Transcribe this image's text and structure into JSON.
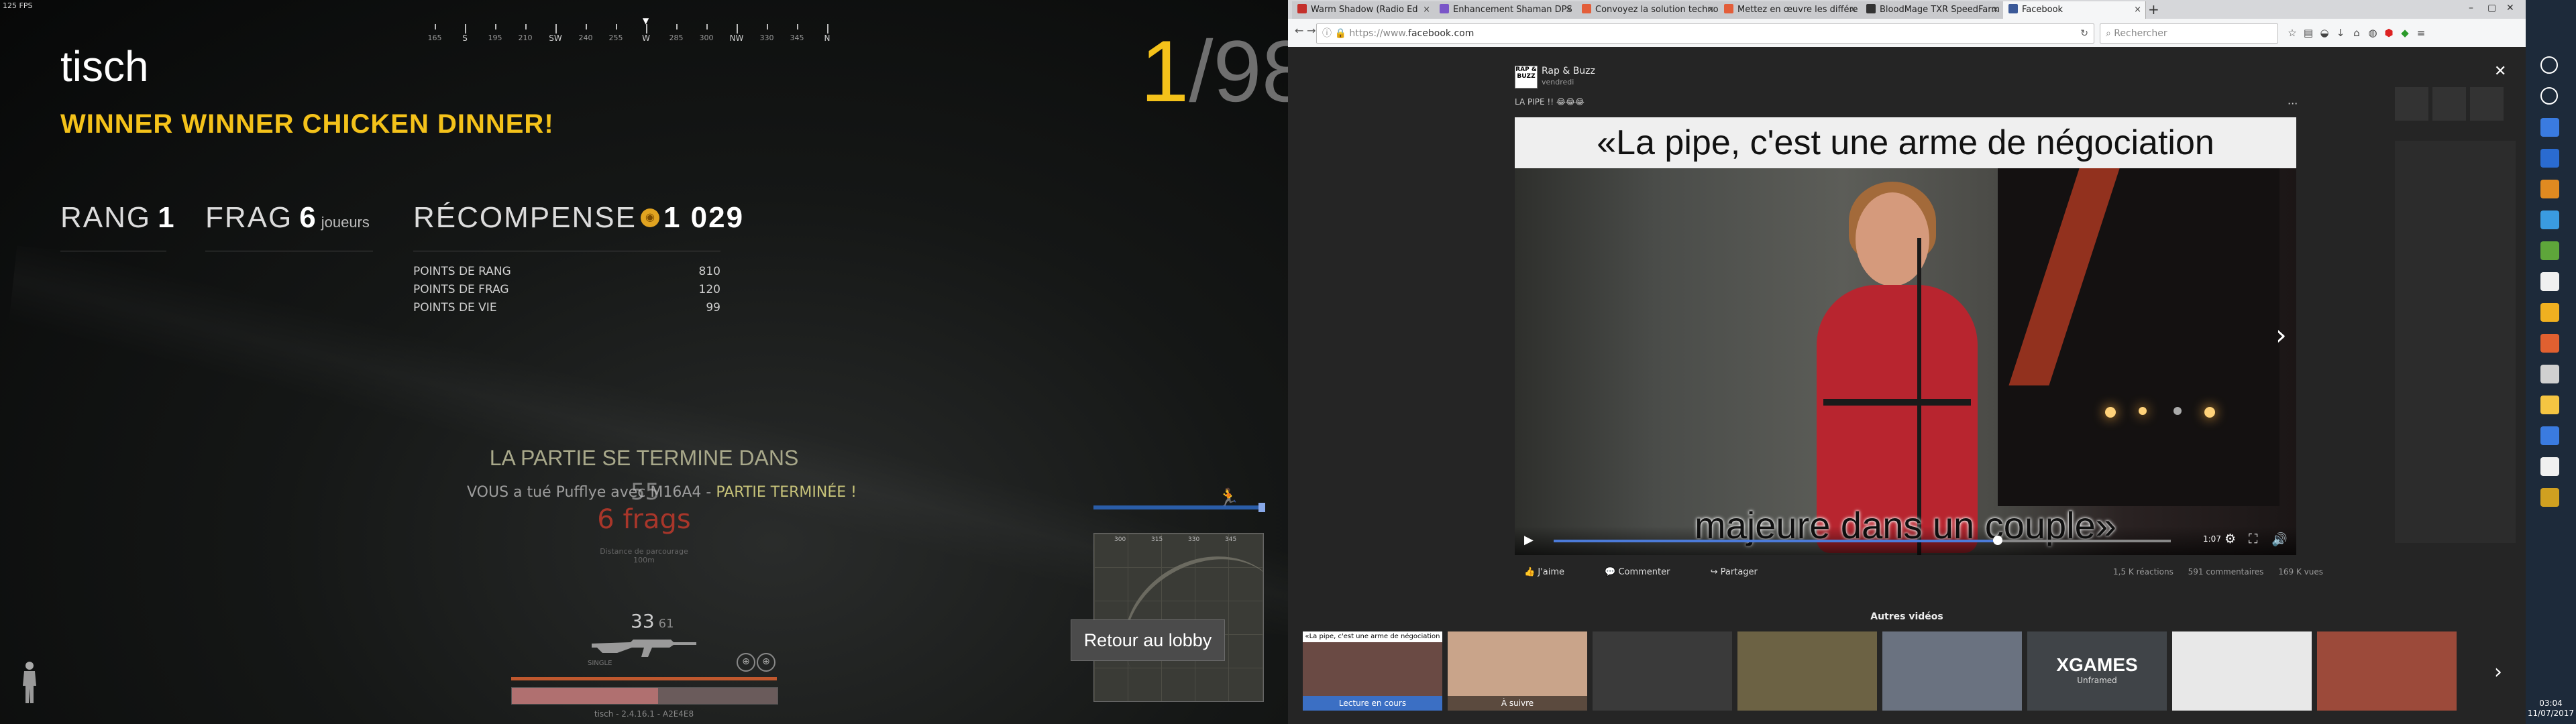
{
  "game": {
    "fps": "125 FPS",
    "compass": [
      {
        "label": "165"
      },
      {
        "label": "S",
        "cardinal": true
      },
      {
        "label": "195"
      },
      {
        "label": "210"
      },
      {
        "label": "SW",
        "cardinal": true
      },
      {
        "label": "240"
      },
      {
        "label": "255"
      },
      {
        "label": "W",
        "cardinal": true
      },
      {
        "label": "285"
      },
      {
        "label": "300"
      },
      {
        "label": "NW",
        "cardinal": true
      },
      {
        "label": "330"
      },
      {
        "label": "345"
      },
      {
        "label": "N",
        "cardinal": true
      }
    ],
    "player_name": "tisch",
    "winner_text": "WINNER WINNER CHICKEN DINNER!",
    "rank_number": "1",
    "rank_sep": "/",
    "rank_total": "98",
    "stats": {
      "rank_label": "RANG",
      "rank_value": "1",
      "frag_label": "FRAG",
      "frag_value": "6",
      "frag_unit": "joueurs",
      "reward_label": "RÉCOMPENSE",
      "reward_value": "1 029"
    },
    "breakdown": [
      {
        "label": "POINTS DE RANG",
        "value": "810"
      },
      {
        "label": "POINTS DE FRAG",
        "value": "120"
      },
      {
        "label": "POINTS DE VIE",
        "value": "99"
      }
    ],
    "ends_title": "LA PARTIE SE TERMINE DANS",
    "kill_message_prefix": "VOUS a tué Pufflye avec",
    "kill_weapon": "M16A4 -",
    "kill_message_suffix": "PARTIE TERMINÉE !",
    "countdown": "55",
    "frags": "6 frags",
    "distance_label": "Distance de parcourage",
    "distance_value": "100m",
    "ammo_current": "33",
    "ammo_reserve": "61",
    "fire_mode": "SINGLE",
    "health_fraction": 1.0,
    "boost_fraction": 0.55,
    "version": "tisch - 2.4.16.1 - A2E4E8",
    "lobby_button": "Retour au lobby",
    "minimap_labels": [
      "300",
      "315",
      "330",
      "345"
    ]
  },
  "browser": {
    "tabs": [
      {
        "title": "Warm Shadow (Radio Ed",
        "color": "#c4302b"
      },
      {
        "title": "Enhancement Shaman DPS",
        "color": "#7a55c8"
      },
      {
        "title": "Convoyez la solution techno",
        "color": "#e35e3a"
      },
      {
        "title": "Mettez en œuvre les différe",
        "color": "#e35e3a"
      },
      {
        "title": "BloodMage TXR SpeedFarm",
        "color": "#333333"
      },
      {
        "title": "Facebook",
        "color": "#3b5998",
        "active": true
      }
    ],
    "url_scheme": "https://www.",
    "url_host": "facebook.com",
    "search_placeholder": "Rechercher",
    "post": {
      "page_avatar": "RAP & BUZZ",
      "page_name": "Rap & Buzz",
      "date": "vendredi",
      "caption": "LA PIPE !! 😂😂😂",
      "video_caption_top": "«La pipe, c'est une arme de négociation",
      "video_caption_bottom": "majeure dans un couple»",
      "video_time": "1:07",
      "progress_fraction": 0.72,
      "actions": [
        "J'aime",
        "Commenter",
        "Partager"
      ],
      "reactions": "1,5 K réactions",
      "comments": "591 commentaires",
      "views": "169 K vues"
    },
    "others_title": "Autres vidéos",
    "thumbnails": [
      {
        "top": "«La pipe, c'est une arme de négociation",
        "caption": "Lecture en cours",
        "now": true,
        "bg": "#6a4a44"
      },
      {
        "caption": "À suivre",
        "bg": "#c9a48a"
      },
      {
        "bg": "#3a3a3a"
      },
      {
        "bg": "#6c6244"
      },
      {
        "bg": "#6a7280"
      },
      {
        "big": "XGAMES",
        "sub": "Unframed",
        "bg": "#404448"
      },
      {
        "bg": "#e8e8e8"
      },
      {
        "bg": "#9c4a3a"
      }
    ]
  },
  "taskbar": {
    "time": "03:04",
    "date": "11/07/2017",
    "icons": [
      "#ffffff",
      "#ffffff",
      "#3a7be0",
      "#2a6bd0",
      "#e08a20",
      "#3a9be0",
      "#5ea63a",
      "#f0f0f0",
      "#f0b020",
      "#e06030",
      "#d0d0d0",
      "#f5c542",
      "#3a7be0",
      "#f0f0f0",
      "#d0a020"
    ]
  },
  "colors": {
    "accent_gold": "#f4c21a",
    "frags_red": "#c0392b",
    "fb_blue": "#3b6fc4"
  }
}
